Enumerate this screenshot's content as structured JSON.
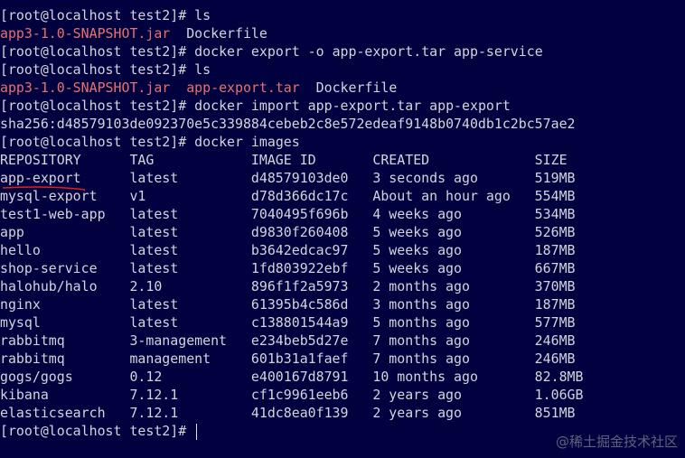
{
  "prompt": "[root@localhost test2]#",
  "lines": {
    "cmd1": "ls",
    "ls1": {
      "jar": "app3-1.0-SNAPSHOT.jar",
      "dockerfile": "Dockerfile"
    },
    "cmd2": "docker export -o app-export.tar app-service",
    "cmd3": "ls",
    "ls2": {
      "jar": "app3-1.0-SNAPSHOT.jar",
      "tar": "app-export.tar",
      "dockerfile": "Dockerfile"
    },
    "cmd4": "docker import app-export.tar app-export",
    "sha": "sha256:d48579103de092370e5c339884cebeb2c8e572edeaf9148b0740db1c2bc57ae2",
    "cmd5": "docker images"
  },
  "table": {
    "headers": [
      "REPOSITORY",
      "TAG",
      "IMAGE ID",
      "CREATED",
      "SIZE"
    ],
    "rows": [
      [
        "app-export",
        "latest",
        "d48579103de0",
        "3 seconds ago",
        "519MB"
      ],
      [
        "mysql-export",
        "v1",
        "d78d366dc17c",
        "About an hour ago",
        "554MB"
      ],
      [
        "test1-web-app",
        "latest",
        "7040495f696b",
        "4 weeks ago",
        "534MB"
      ],
      [
        "app",
        "latest",
        "d9830f260408",
        "5 weeks ago",
        "526MB"
      ],
      [
        "hello",
        "latest",
        "b3642edcac97",
        "5 weeks ago",
        "187MB"
      ],
      [
        "shop-service",
        "latest",
        "1fd803922ebf",
        "5 weeks ago",
        "667MB"
      ],
      [
        "halohub/halo",
        "2.10",
        "896f1f2a5973",
        "2 months ago",
        "370MB"
      ],
      [
        "nginx",
        "latest",
        "61395b4c586d",
        "3 months ago",
        "187MB"
      ],
      [
        "mysql",
        "latest",
        "c138801544a9",
        "5 months ago",
        "577MB"
      ],
      [
        "rabbitmq",
        "3-management",
        "e234beb5d27e",
        "7 months ago",
        "246MB"
      ],
      [
        "rabbitmq",
        "management",
        "601b31a1faef",
        "7 months ago",
        "246MB"
      ],
      [
        "gogs/gogs",
        "0.12",
        "e400167d8791",
        "10 months ago",
        "82.8MB"
      ],
      [
        "kibana",
        "7.12.1",
        "cf1c9961eeb6",
        "2 years ago",
        "1.06GB"
      ],
      [
        "elasticsearch",
        "7.12.1",
        "41dc8ea0f139",
        "2 years ago",
        "851MB"
      ]
    ]
  },
  "watermark": "@稀土掘金技术社区",
  "colors": {
    "background": "#01013f",
    "text": "#d4d4dc",
    "file_highlight": "#e8706e",
    "annotation": "#e02020"
  }
}
